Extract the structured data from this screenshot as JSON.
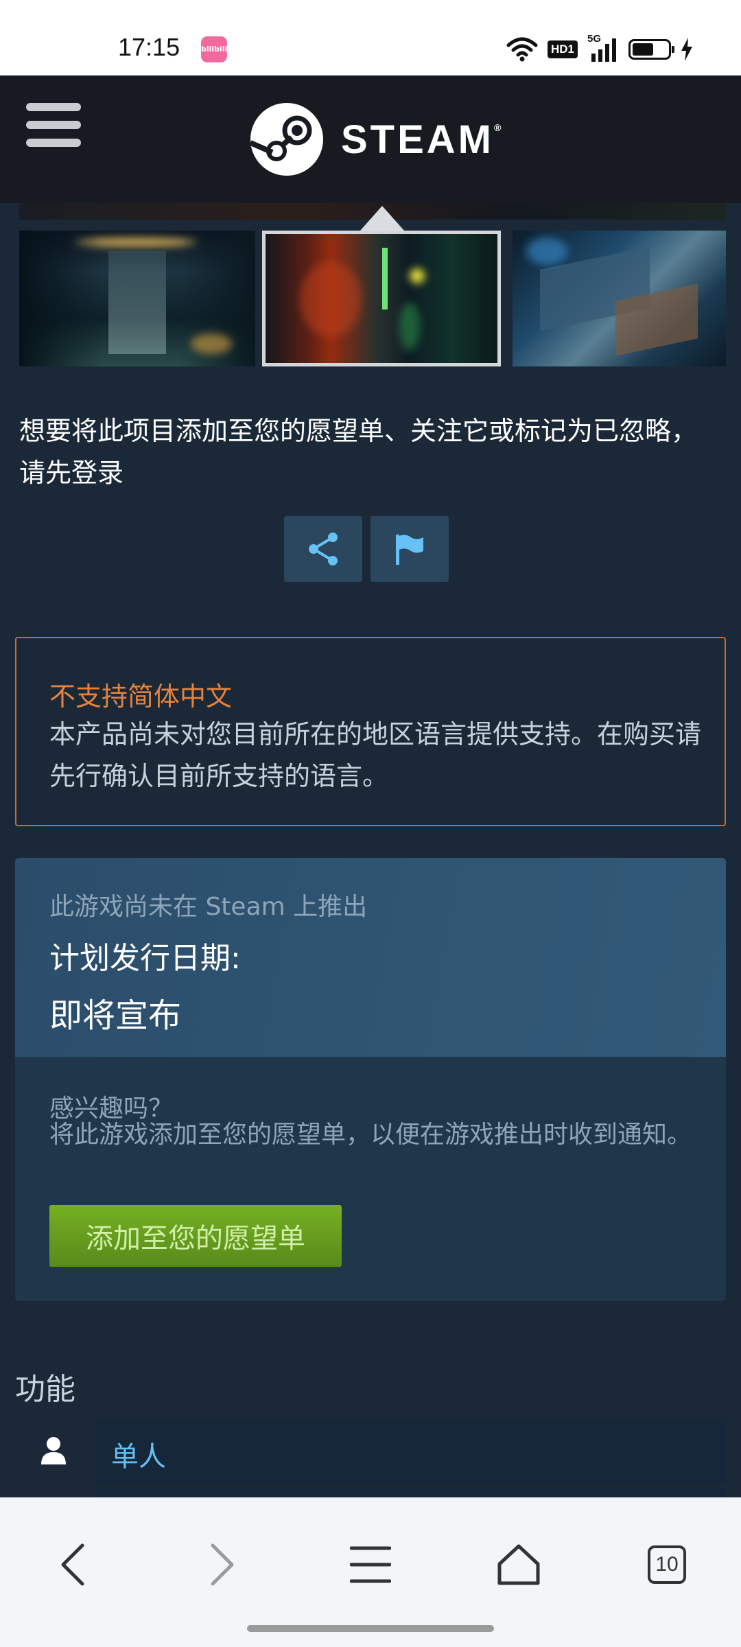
{
  "status_bar": {
    "time": "17:15",
    "app_badge": "bilibili",
    "network_badge": "HD1",
    "signal_label": "5G",
    "battery_level": 0.6
  },
  "header": {
    "brand": "STEAM",
    "trademark": "®"
  },
  "media": {
    "selected_index": 1,
    "thumbnails": [
      "screenshot-1",
      "screenshot-2",
      "screenshot-3"
    ]
  },
  "login_note": "想要将此项目添加至您的愿望单、关注它或标记为已忽略，请先登录",
  "actions": {
    "share_icon": "share-icon",
    "report_icon": "flag-icon"
  },
  "language_warning": {
    "title": "不支持简体中文",
    "body": "本产品尚未对您目前所在的地区语言提供支持。在购买请先行确认目前所支持的语言。",
    "accent_color": "#e6823c"
  },
  "release": {
    "status": "此游戏尚未在 Steam 上推出",
    "date_label": "计划发行日期:",
    "date_value": "即将宣布",
    "interest_title": "感兴趣吗？",
    "interest_body": "将此游戏添加至您的愿望单，以便在游戏推出时收到通知。",
    "wishlist_button": "添加至您的愿望单"
  },
  "features": {
    "title": "功能",
    "items": [
      {
        "icon": "single-player-icon",
        "label": "单人"
      }
    ]
  },
  "browser_nav": {
    "tab_count": "10"
  },
  "colors": {
    "page_bg": "#1b2838",
    "header_bg": "#171a21",
    "link": "#66c0f4",
    "wishlist_green": "#75b022"
  }
}
